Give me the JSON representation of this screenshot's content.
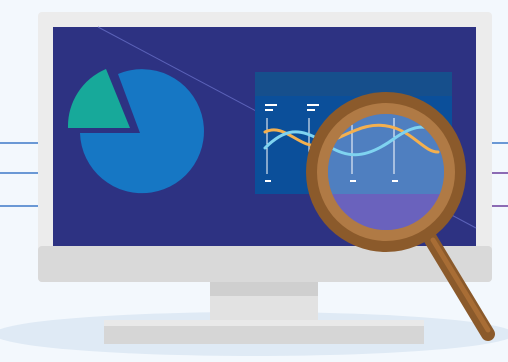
{
  "illustration": {
    "subject": "monitor-with-magnifier",
    "icons": [
      "monitor-icon",
      "pie-chart-icon",
      "line-chart-icon",
      "magnifying-glass-icon"
    ],
    "colors": {
      "background": "#f3f8fd",
      "floor_shadow": "#dfeaf5",
      "monitor_frame": "#ececec",
      "monitor_chin": "#d9d9d9",
      "stand": "#e2e2e2",
      "stand_base": "#cfcfcf",
      "screen": "#2d3282",
      "pie_main": "#1677c4",
      "pie_slice": "#17a99a",
      "panel": "#0b4f9a",
      "panel_header": "#164f8c",
      "wave_1": "#f4b04f",
      "wave_2": "#7fd3f0",
      "lens_ring": "#8b5a2b",
      "lens_ring_light": "#b07a45",
      "lens_glass": "#6a78c9",
      "handle": "#8b5a2b",
      "side_line_blue": "#3c78c8",
      "side_line_purple": "#6a3c9c"
    }
  }
}
